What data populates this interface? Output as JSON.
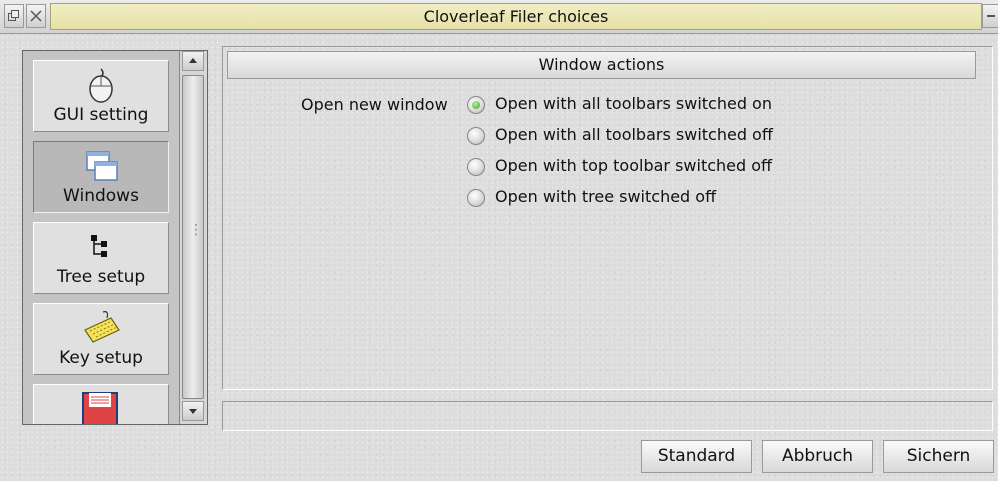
{
  "window": {
    "title": "Cloverleaf Filer choices"
  },
  "sidebar": {
    "items": [
      {
        "label": "GUI setting",
        "icon": "mouse-icon"
      },
      {
        "label": "Windows",
        "icon": "windows-icon",
        "selected": true
      },
      {
        "label": "Tree setup",
        "icon": "tree-icon"
      },
      {
        "label": "Key setup",
        "icon": "keyboard-icon"
      },
      {
        "label": "",
        "icon": "floppy-disk-icon"
      }
    ]
  },
  "section": {
    "title": "Window actions",
    "field_label": "Open new window",
    "options": [
      {
        "label": "Open with all toolbars switched on",
        "selected": true
      },
      {
        "label": "Open with all toolbars switched off",
        "selected": false
      },
      {
        "label": "Open with top toolbar switched off",
        "selected": false
      },
      {
        "label": "Open with tree switched off",
        "selected": false
      }
    ]
  },
  "status_bar": {
    "text": ""
  },
  "buttons": {
    "standard": "Standard",
    "cancel": "Abbruch",
    "save": "Sichern"
  },
  "colors": {
    "title_field": "#e9e3ae",
    "radio_selected": "#39a626"
  }
}
